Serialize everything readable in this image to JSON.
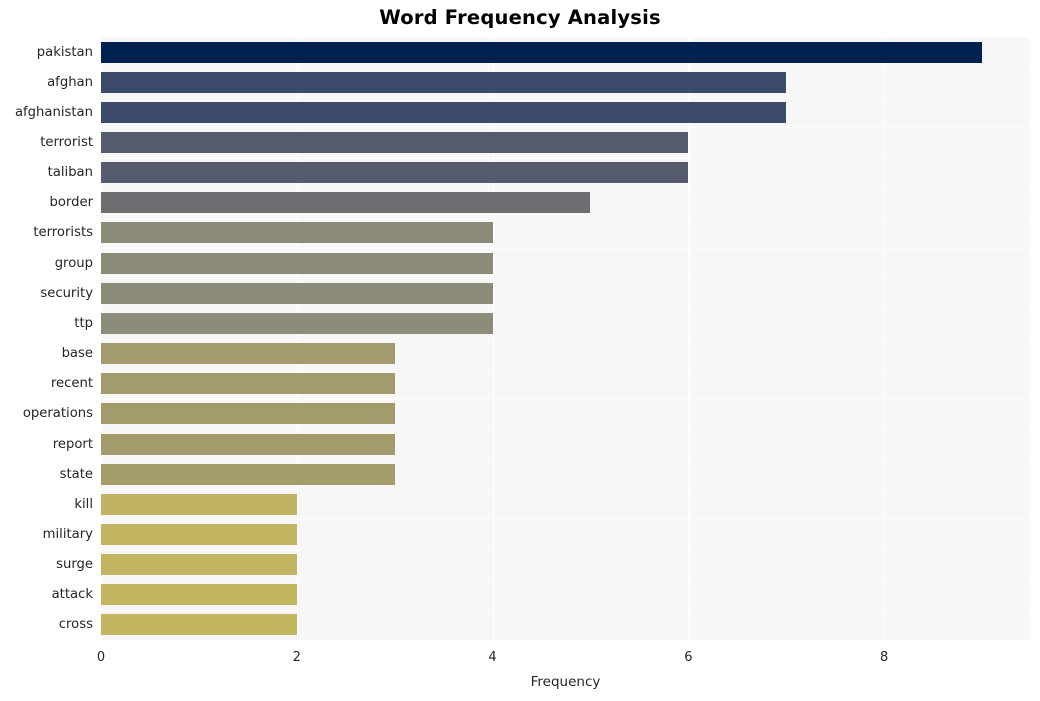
{
  "chart_data": {
    "type": "bar",
    "orientation": "horizontal",
    "title": "Word Frequency Analysis",
    "xlabel": "Frequency",
    "ylabel": "",
    "categories": [
      "pakistan",
      "afghan",
      "afghanistan",
      "terrorist",
      "taliban",
      "border",
      "terrorists",
      "group",
      "security",
      "ttp",
      "base",
      "recent",
      "operations",
      "report",
      "state",
      "kill",
      "military",
      "surge",
      "attack",
      "cross"
    ],
    "values": [
      9,
      7,
      7,
      6,
      6,
      5,
      4,
      4,
      4,
      4,
      3,
      3,
      3,
      3,
      3,
      2,
      2,
      2,
      2,
      2
    ],
    "bar_colors": [
      "#00224e",
      "#3b4a6b",
      "#3c4b6c",
      "#555b6d",
      "#565c6e",
      "#6c6e72",
      "#8b8978",
      "#8c8a79",
      "#8c8a79",
      "#8d8b79",
      "#a39a6d",
      "#a39a6d",
      "#a49b6d",
      "#a49b6d",
      "#a59c6c",
      "#c2b362",
      "#c3b461",
      "#c3b461",
      "#c4b561",
      "#c4b561"
    ],
    "xticks": [
      "0",
      "2",
      "4",
      "6",
      "8"
    ],
    "xtick_values": [
      0,
      2,
      4,
      6,
      8
    ],
    "xlim": [
      0,
      9.49
    ],
    "grid": true,
    "grid_axis": "x",
    "grid_color": "#ffffff",
    "plot_background": "#f7f7f7",
    "figure_background": "#ffffff",
    "style": "whitegrid",
    "colormap": "cividis"
  }
}
